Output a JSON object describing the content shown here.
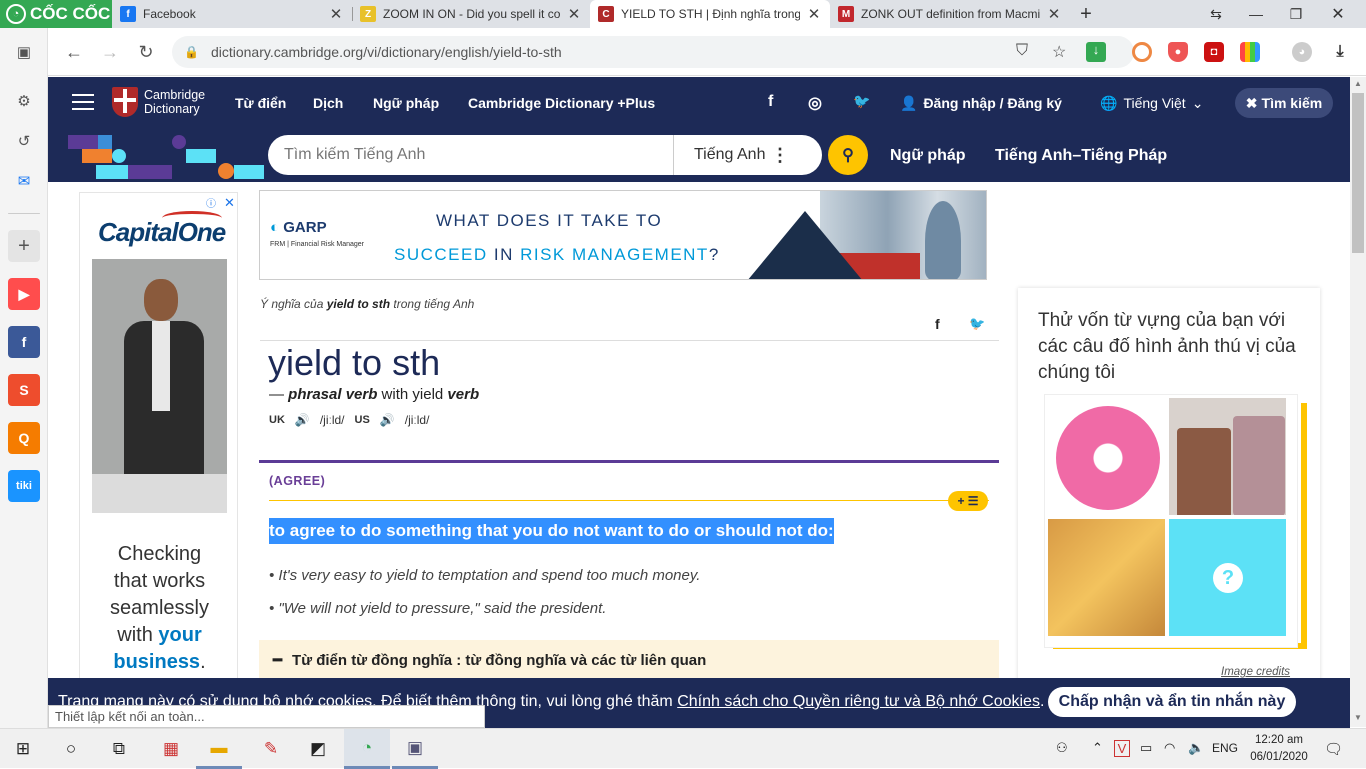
{
  "browser": {
    "brand": "CỐC CỐC",
    "tabs": [
      {
        "title": "Facebook",
        "color": "#1877f2",
        "glyph": "f"
      },
      {
        "title": "ZOOM IN ON - Did you spell it corr",
        "color": "#e8c12a",
        "glyph": "Z"
      },
      {
        "title": "YIELD TO STH | Định nghĩa trong Tiếng",
        "color": "#b02a2a",
        "glyph": "C"
      },
      {
        "title": "ZONK OUT definition from Macmillan",
        "color": "#c1272d",
        "glyph": "M"
      }
    ],
    "new_tab": "+",
    "url": "dictionary.cambridge.org/vi/dictionary/english/yield-to-sth",
    "status_text": "Thiết lập kết nối an toàn..."
  },
  "sidebar_apps": [
    {
      "name": "youtube",
      "color": "#ff4d4d",
      "glyph": "▶"
    },
    {
      "name": "facebook",
      "color": "#3b5998",
      "glyph": "f"
    },
    {
      "name": "shopee",
      "color": "#ee4d2d",
      "glyph": "S"
    },
    {
      "name": "search",
      "color": "#f57c00",
      "glyph": "Q"
    },
    {
      "name": "tiki",
      "color": "#1a94ff",
      "glyph": "tiki"
    }
  ],
  "site": {
    "logo_line1": "Cambridge",
    "logo_line2": "Dictionary",
    "nav": [
      "Từ điển",
      "Dịch",
      "Ngữ pháp",
      "Cambridge Dictionary +Plus"
    ],
    "login": "Đăng nhập / Đăng ký",
    "language": "Tiếng Việt",
    "search_button": "Tìm kiếm",
    "search_placeholder": "Tìm kiếm Tiếng Anh",
    "search_lang": "Tiếng Anh",
    "links": [
      "Ngữ pháp",
      "Tiếng Anh–Tiếng Pháp"
    ]
  },
  "left_ad": {
    "brand_a": "Capital",
    "brand_b": "One",
    "line1": "Checking",
    "line2": "that works",
    "line3": "seamlessly",
    "line4a": "with ",
    "line4b": "your",
    "line5": "business",
    "line5_end": "."
  },
  "top_ad": {
    "brand": "GARP",
    "brand_sub": "FRM | Financial Risk Manager",
    "line1": "WHAT DOES IT TAKE TO",
    "line2a": "SUCCEED",
    "line2b": " IN ",
    "line2c": "RISK MANAGEMENT",
    "line2d": "?"
  },
  "entry": {
    "crumb_a": "Ý nghĩa của ",
    "crumb_b": "yield to sth",
    "crumb_c": " trong tiếng Anh",
    "headword": "yield to sth",
    "pos_dash": "— ",
    "pos": "phrasal verb",
    "pos_with": " with yield ",
    "pos_verb": "verb",
    "uk": "UK",
    "uk_ipa": "/jiːld/",
    "us": "US",
    "us_ipa": "/jiːld/",
    "guideword": "(AGREE)",
    "plus_label": "+",
    "definition": "to agree to do something that you do not want to do or should not do:",
    "examples": [
      "It's very easy to yield to temptation and spend too much money.",
      "\"We will not yield to pressure,\" said the president."
    ],
    "thesaurus": "Từ điển từ đồng nghĩa : từ đồng nghĩa và các từ liên quan"
  },
  "quiz": {
    "title": "Thử vốn từ vựng của bạn với các câu đố hình ảnh thú vị của chúng tôi",
    "qmark": "?",
    "credits": "Image credits"
  },
  "cookie": {
    "text_a": "Trang mạng này có sử dụng bộ nhớ cookies. Để biết thêm thông tin, vui lòng ghé thăm ",
    "link": "Chính sách cho Quyền riêng tư và Bộ nhớ Cookies",
    "text_b": ".",
    "button": "Chấp nhận và ẩn tin nhắn này"
  },
  "taskbar": {
    "lang": "ENG",
    "time": "12:20 am",
    "date": "06/01/2020"
  }
}
